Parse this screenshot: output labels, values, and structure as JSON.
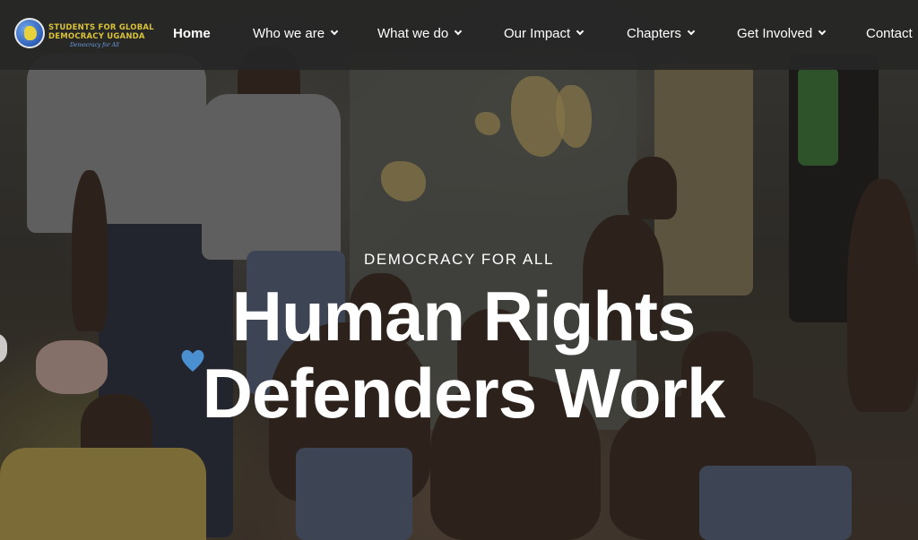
{
  "logo": {
    "line1": "STUDENTS FOR GLOBAL",
    "line2": "DEMOCRACY UGANDA",
    "tagline": "Democracy for All"
  },
  "nav": {
    "items": [
      {
        "label": "Home",
        "active": true,
        "dropdown": false
      },
      {
        "label": "Who we are",
        "active": false,
        "dropdown": true
      },
      {
        "label": "What we do",
        "active": false,
        "dropdown": true
      },
      {
        "label": "Our Impact",
        "active": false,
        "dropdown": true
      },
      {
        "label": "Chapters",
        "active": false,
        "dropdown": true
      },
      {
        "label": "Get Involved",
        "active": false,
        "dropdown": true
      },
      {
        "label": "Contact",
        "active": false,
        "dropdown": false
      }
    ]
  },
  "hero": {
    "eyebrow": "DEMOCRACY FOR ALL",
    "headline_line1": "Human Rights",
    "headline_line2": "Defenders Work",
    "heart_icon": "heart-icon"
  },
  "colors": {
    "nav_bg": "#262626",
    "logo_text": "#d8c23a",
    "logo_tagline": "#6ea0e6",
    "heart": "#4a90d0",
    "text": "#ffffff"
  }
}
